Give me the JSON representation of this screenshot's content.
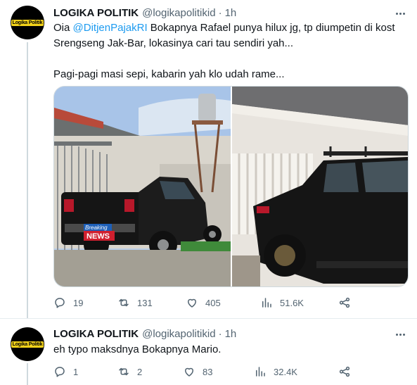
{
  "tweets": [
    {
      "avatar_text": "Logika Politik",
      "name": "LOGIKA POLITIK",
      "handle": "@logikapolitikid",
      "separator": "·",
      "time": "1h",
      "text_1a": "Oia ",
      "mention": "@DitjenPajakRI",
      "text_1b": " Bokapnya Rafael punya hilux jg, tp diumpetin di kost Srengseng Jak-Bar, lokasinya cari tau sendiri yah...",
      "text_2": "Pagi-pagi masi sepi, kabarin yah klo udah rame...",
      "photo_badge_top": "Breaking",
      "photo_badge_bottom": "NEWS",
      "replies": "19",
      "retweets": "131",
      "likes": "405",
      "views": "51.6K"
    },
    {
      "avatar_text": "Logika Politik",
      "name": "LOGIKA POLITIK",
      "handle": "@logikapolitikid",
      "separator": "·",
      "time": "1h",
      "text": "eh typo maksdnya Bokapnya Mario.",
      "replies": "1",
      "retweets": "2",
      "likes": "83",
      "views": "32.4K"
    }
  ],
  "icons": {
    "reply": "reply-icon",
    "retweet": "retweet-icon",
    "like": "heart-icon",
    "views": "views-icon",
    "share": "share-icon",
    "more": "more-icon"
  },
  "colors": {
    "link": "#1d9bf0",
    "secondary_text": "#536471",
    "thread_line": "#cfd9de"
  }
}
